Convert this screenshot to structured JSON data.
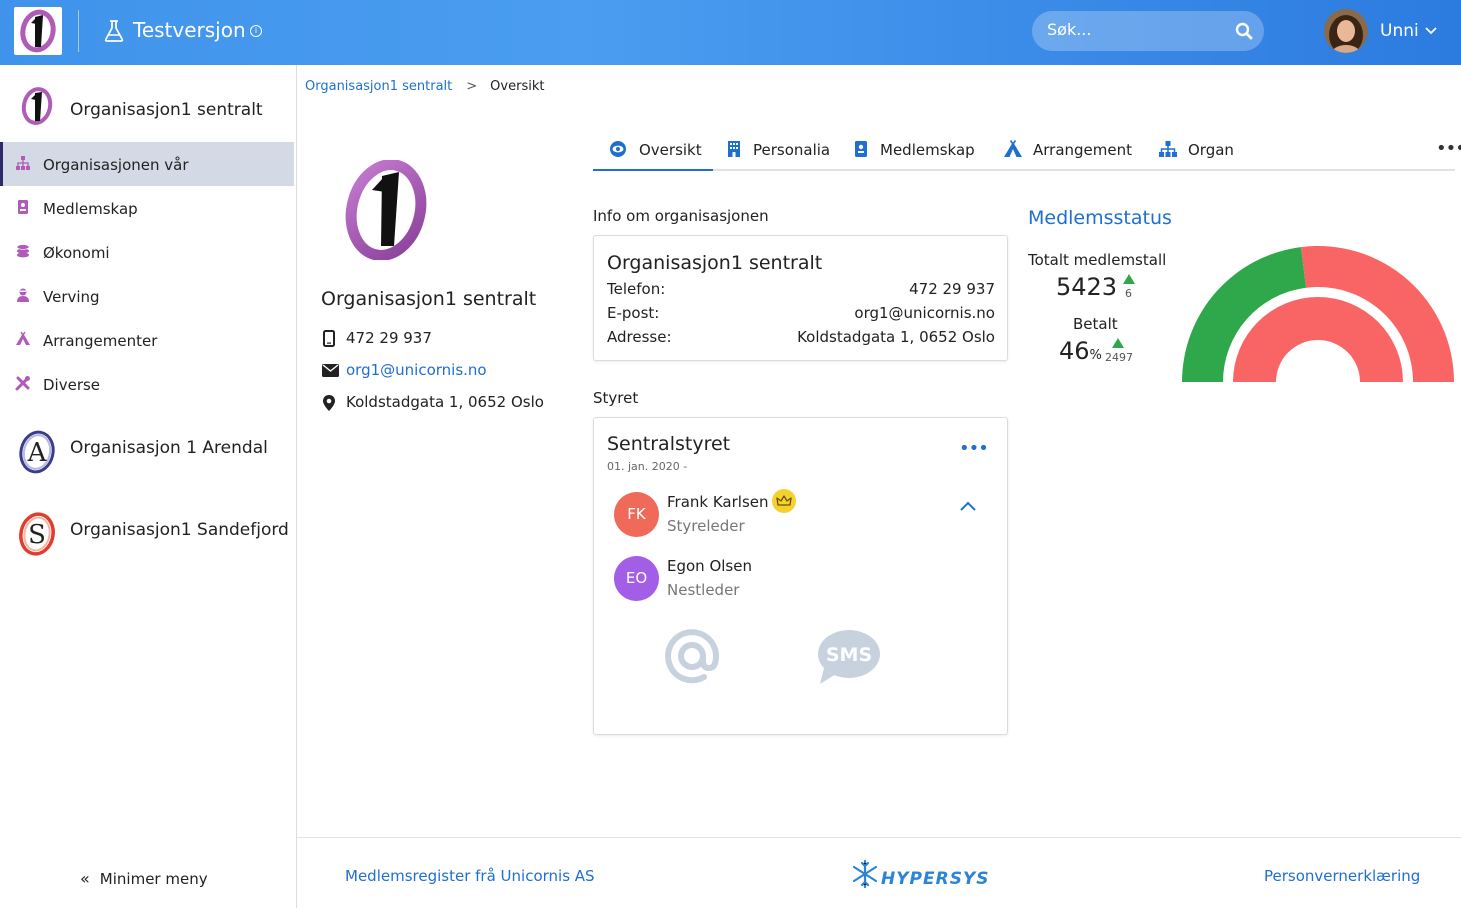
{
  "topbar": {
    "env_title": "Testversjon",
    "env_info_glyph": "i",
    "search_placeholder": "Søk...",
    "user_name": "Unni"
  },
  "sidebar": {
    "org_main": "Organisasjon1 sentralt",
    "items": [
      {
        "label": "Organisasjonen vår",
        "icon": "sitemap-icon",
        "active": true
      },
      {
        "label": "Medlemskap",
        "icon": "id-badge-icon"
      },
      {
        "label": "Økonomi",
        "icon": "coins-icon"
      },
      {
        "label": "Verving",
        "icon": "user-recruit-icon"
      },
      {
        "label": "Arrangementer",
        "icon": "campground-icon"
      },
      {
        "label": "Diverse",
        "icon": "tools-icon"
      }
    ],
    "other_orgs": [
      {
        "label": "Organisasjon 1 Arendal",
        "logo_letter": "A"
      },
      {
        "label": "Organisasjon1 Sandefjord",
        "logo_letter": "S"
      }
    ],
    "minimize_label": "Minimer meny",
    "minimize_glyph": "«"
  },
  "breadcrumb": {
    "parent": "Organisasjon1 sentralt",
    "separator": ">",
    "current": "Oversikt"
  },
  "profile": {
    "name": "Organisasjon1 sentralt",
    "phone": "472 29 937",
    "email": "org1@unicornis.no",
    "address": "Koldstadgata 1, 0652 Oslo"
  },
  "tabs": [
    {
      "label": "Oversikt",
      "icon": "eye-icon",
      "active": true
    },
    {
      "label": "Personalia",
      "icon": "building-icon"
    },
    {
      "label": "Medlemskap",
      "icon": "id-badge-icon"
    },
    {
      "label": "Arrangement",
      "icon": "campground-icon"
    },
    {
      "label": "Organ",
      "icon": "sitemap-icon"
    }
  ],
  "tabs_more": "•••",
  "info": {
    "section_title": "Info om organisasjonen",
    "card_title": "Organisasjon1 sentralt",
    "rows": [
      {
        "key": "Telefon:",
        "value": "472 29 937"
      },
      {
        "key": "E-post:",
        "value": "org1@unicornis.no"
      },
      {
        "key": "Adresse:",
        "value": "Koldstadgata 1, 0652 Oslo"
      }
    ]
  },
  "board": {
    "section_title": "Styret",
    "title": "Sentralstyret",
    "date": "01. jan. 2020 -",
    "more": "•••",
    "members": [
      {
        "initials": "FK",
        "name": "Frank Karlsen",
        "role": "Styreleder",
        "color": "#f06a5a",
        "leader": true
      },
      {
        "initials": "EO",
        "name": "Egon Olsen",
        "role": "Nestleder",
        "color": "#a35ee8",
        "leader": false
      }
    ],
    "sms_label": "SMS"
  },
  "member_status": {
    "title": "Medlemsstatus",
    "total_label": "Totalt medlemstall",
    "total_value": "5423",
    "total_delta": "6",
    "paid_label": "Betalt",
    "paid_value": "46",
    "paid_unit": "%",
    "paid_delta": "2497",
    "paid_fraction": 0.46,
    "colors": {
      "green": "#2ea84a",
      "red": "#f96464"
    }
  },
  "footer": {
    "left": "Medlemsregister frå Unicornis AS",
    "logo_text": "HYPERSYS",
    "right": "Personvernerklæring"
  }
}
